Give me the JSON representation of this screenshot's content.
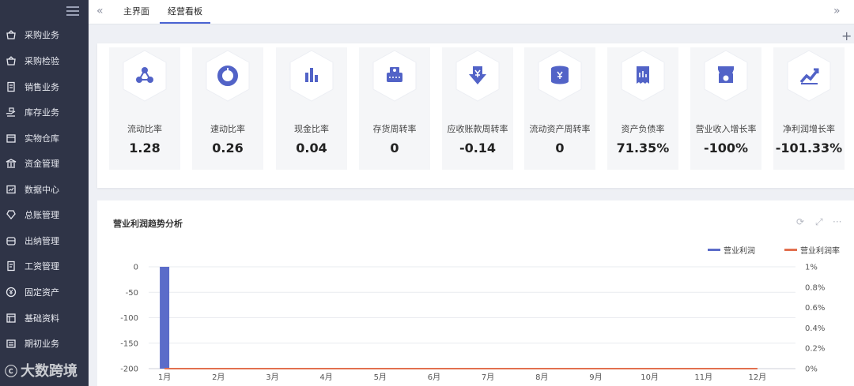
{
  "sidebar": {
    "items": [
      {
        "label": "采购业务",
        "icon": "basket-icon"
      },
      {
        "label": "采购检验",
        "icon": "basket-check-icon"
      },
      {
        "label": "销售业务",
        "icon": "document-icon"
      },
      {
        "label": "库存业务",
        "icon": "warehouse-hand-icon"
      },
      {
        "label": "实物仓库",
        "icon": "box-icon"
      },
      {
        "label": "资金管理",
        "icon": "bank-icon"
      },
      {
        "label": "数据中心",
        "icon": "data-icon"
      },
      {
        "label": "总账管理",
        "icon": "ledger-icon"
      },
      {
        "label": "出纳管理",
        "icon": "cashier-icon"
      },
      {
        "label": "工资管理",
        "icon": "salary-icon"
      },
      {
        "label": "固定资产",
        "icon": "yen-circle-icon"
      },
      {
        "label": "基础资料",
        "icon": "grid-doc-icon"
      },
      {
        "label": "期初业务",
        "icon": "calendar-icon"
      }
    ],
    "watermark": "大数跨境"
  },
  "tabs": {
    "prev": "«",
    "next": "»",
    "items": [
      {
        "label": "主界面",
        "active": false
      },
      {
        "label": "经营看板",
        "active": true
      }
    ]
  },
  "toolbar": {
    "plus": "+"
  },
  "accent_color": "#5263c7",
  "kpis": [
    {
      "label": "流动比率",
      "value": "1.28",
      "icon": "share-nodes-icon"
    },
    {
      "label": "速动比率",
      "value": "0.26",
      "icon": "donut-icon"
    },
    {
      "label": "现金比率",
      "value": "0.04",
      "icon": "bar-chart-icon"
    },
    {
      "label": "存货周转率",
      "value": "0",
      "icon": "cash-register-icon"
    },
    {
      "label": "应收账款周转率",
      "value": "-0.14",
      "icon": "yen-down-arrow-icon"
    },
    {
      "label": "流动资产周转率",
      "value": "0",
      "icon": "yen-coin-stack-icon"
    },
    {
      "label": "资产负债率",
      "value": "71.35%",
      "icon": "receipt-icon"
    },
    {
      "label": "营业收入增长率",
      "value": "-100%",
      "icon": "store-icon"
    },
    {
      "label": "净利润增长率",
      "value": "-101.33%",
      "icon": "trend-up-icon"
    }
  ],
  "chart_panel": {
    "title": "营业利润趋势分析",
    "tools": {
      "refresh": "⟳",
      "expand": "⤢",
      "more": "···"
    }
  },
  "chart_data": {
    "type": "bar",
    "categories": [
      "1月",
      "2月",
      "3月",
      "4月",
      "5月",
      "6月",
      "7月",
      "8月",
      "9月",
      "10月",
      "11月",
      "12月"
    ],
    "series": [
      {
        "name": "营业利润",
        "kind": "bar",
        "axis": "left",
        "color": "#5b6cc9",
        "values": [
          -200,
          0,
          0,
          0,
          0,
          0,
          0,
          0,
          0,
          0,
          0,
          0
        ]
      },
      {
        "name": "营业利润率",
        "kind": "line",
        "axis": "right",
        "color": "#e2704f",
        "values": [
          0,
          0,
          0,
          0,
          0,
          0,
          0,
          0,
          0,
          0,
          0,
          0
        ]
      }
    ],
    "y_left": {
      "ticks": [
        "0",
        "-50",
        "-100",
        "-150",
        "-200"
      ],
      "range": [
        -200,
        0
      ]
    },
    "y_right": {
      "ticks": [
        "1%",
        "0.8%",
        "0.6%",
        "0.4%",
        "0.2%",
        "0%"
      ],
      "range": [
        0,
        1
      ]
    },
    "legend_position": "top-right",
    "grid": true
  }
}
